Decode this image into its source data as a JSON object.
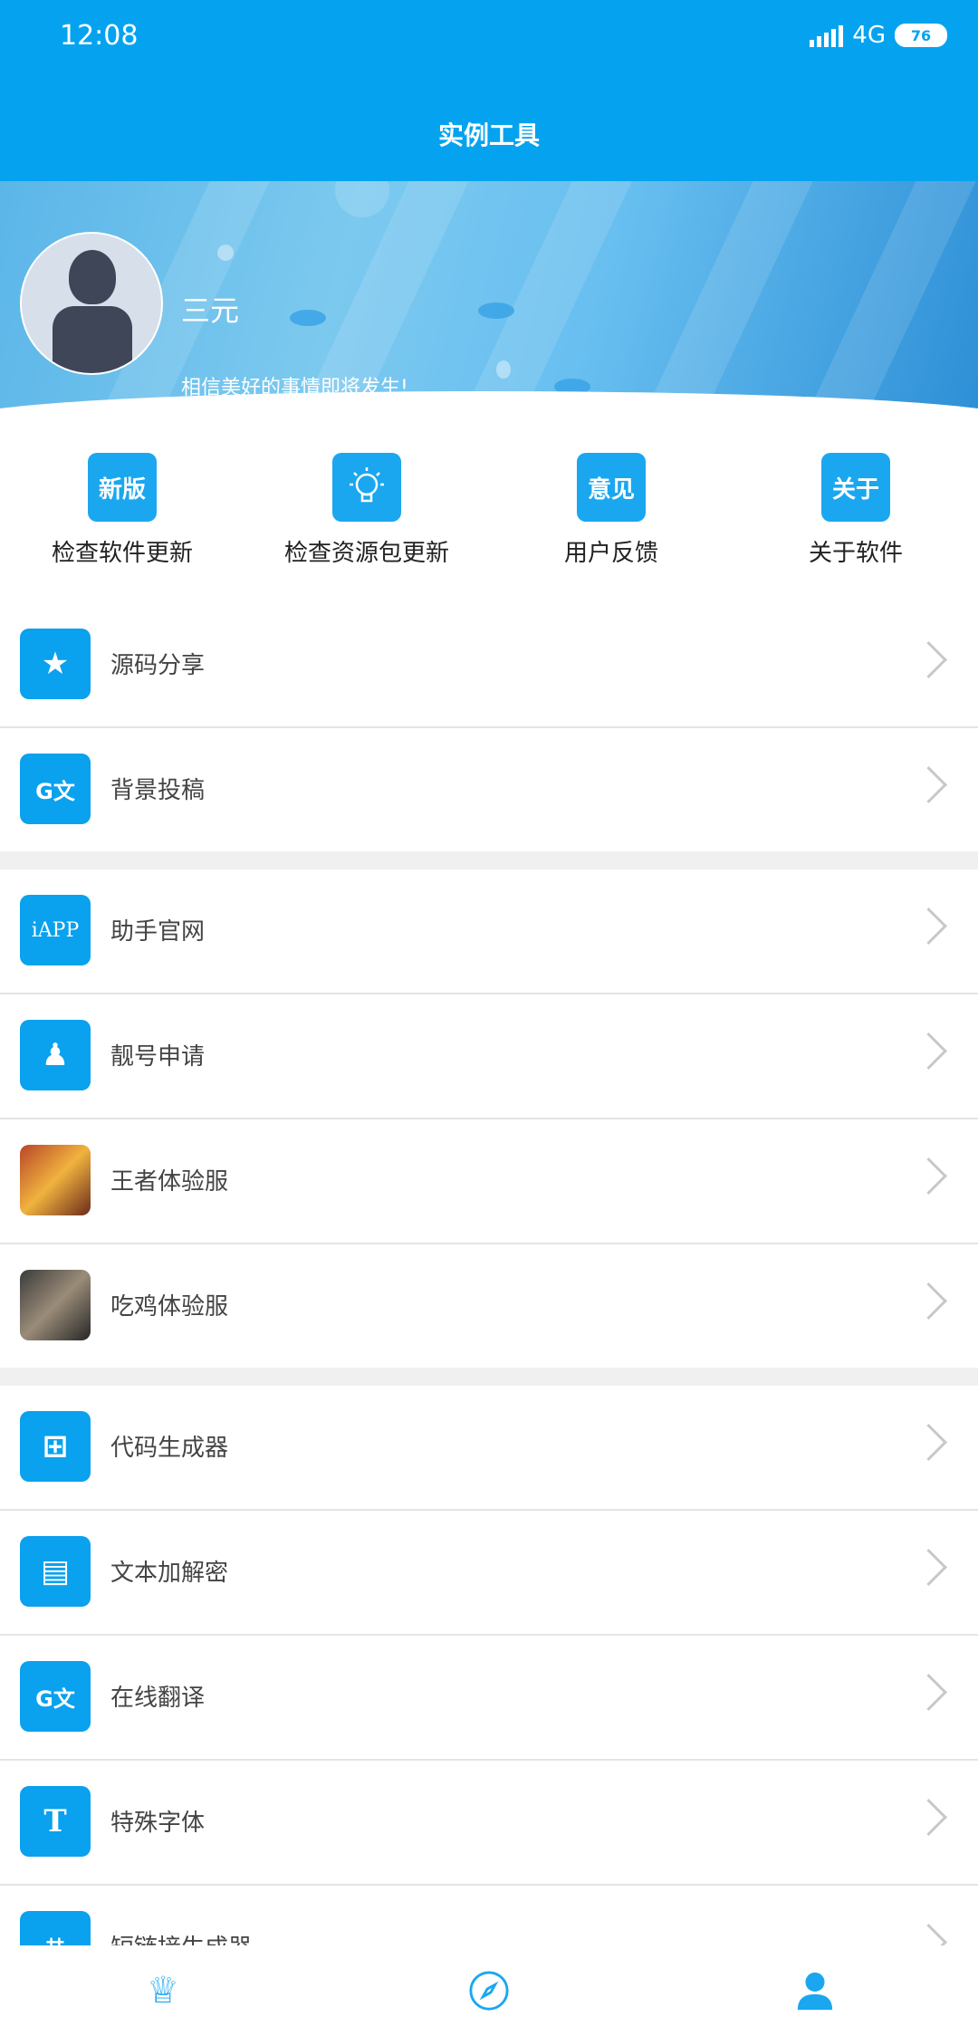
{
  "status": {
    "time": "12:08",
    "network": "4G",
    "battery": "76"
  },
  "header": {
    "title": "实例工具"
  },
  "profile": {
    "name": "三元",
    "motto": "相信美好的事情即将发生!"
  },
  "quick_actions": [
    {
      "icon_text": "新版",
      "label": "检查软件更新",
      "icon": "new-version-icon"
    },
    {
      "icon_text": "",
      "label": "检查资源包更新",
      "icon": "lightbulb-icon"
    },
    {
      "icon_text": "意见",
      "label": "用户反馈",
      "icon": "feedback-icon"
    },
    {
      "icon_text": "关于",
      "label": "关于软件",
      "icon": "about-icon"
    }
  ],
  "menu": {
    "groups": [
      [
        {
          "label": "源码分享",
          "icon": "star-icon",
          "icon_text": "★"
        },
        {
          "label": "背景投稿",
          "icon": "translate-icon",
          "icon_text": "G文"
        }
      ],
      [
        {
          "label": "助手官网",
          "icon": "iapp-icon",
          "icon_text": "iAPP"
        },
        {
          "label": "靓号申请",
          "icon": "qq-icon",
          "icon_text": "♟"
        },
        {
          "label": "王者体验服",
          "icon": "honor-of-kings-icon",
          "icon_text": ""
        },
        {
          "label": "吃鸡体验服",
          "icon": "pubg-icon",
          "icon_text": ""
        }
      ],
      [
        {
          "label": "代码生成器",
          "icon": "add-copy-icon",
          "icon_text": "⊞"
        },
        {
          "label": "文本加解密",
          "icon": "document-icon",
          "icon_text": "▤"
        },
        {
          "label": "在线翻译",
          "icon": "translate-icon",
          "icon_text": "G文"
        },
        {
          "label": "特殊字体",
          "icon": "font-icon",
          "icon_text": "T"
        },
        {
          "label": "短链接生成器",
          "icon": "chip-icon",
          "icon_text": "⌗"
        }
      ]
    ]
  },
  "bottom_nav": [
    {
      "name": "crown-icon",
      "glyph": "♕"
    },
    {
      "name": "compass-icon",
      "glyph": "⊘"
    },
    {
      "name": "user-icon",
      "glyph": "👤"
    }
  ]
}
